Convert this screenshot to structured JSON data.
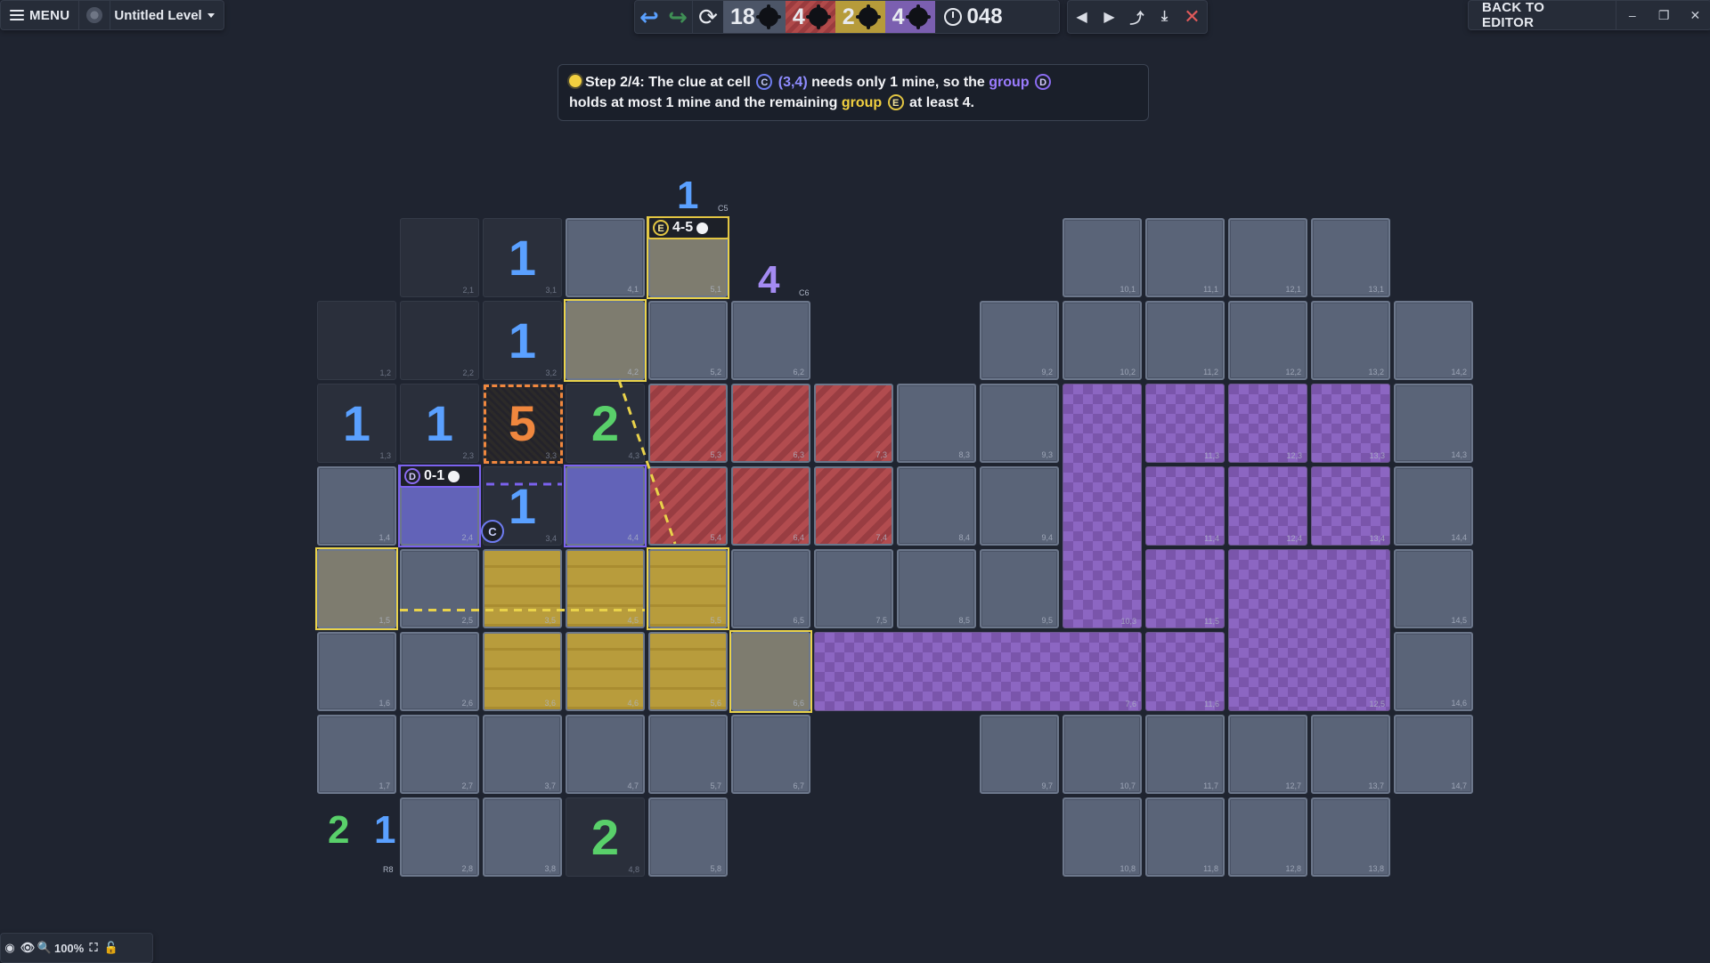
{
  "menu": {
    "label": "MENU"
  },
  "level": {
    "title": "Untitled Level"
  },
  "topbar": {
    "undo_icon": "↩",
    "redo_icon": "↪",
    "restart_icon": "⟳",
    "mine_counts": [
      {
        "id": "total",
        "value": "18",
        "color": "#4c5567"
      },
      {
        "id": "red",
        "value": "4",
        "color": "#b14a4a"
      },
      {
        "id": "yellow",
        "value": "2",
        "color": "#b69b3a"
      },
      {
        "id": "purple",
        "value": "4",
        "color": "#7b5fb0"
      }
    ],
    "timer": "048"
  },
  "nav": {
    "prev": "◀",
    "next": "▶",
    "share": "⤴",
    "download": "⤓",
    "close": "✕"
  },
  "window": {
    "back_to_editor": "BACK TO EDITOR",
    "minimize": "–",
    "restore": "❐",
    "close": "✕"
  },
  "hint": {
    "step": "Step 2/4:",
    "t1": " The clue at cell ",
    "chip_c": "C",
    "cell_ref": "(3,4)",
    "t2": " needs only 1 mine, so the ",
    "group_word_d": "group",
    "chip_d": "D",
    "t3": "holds at most 1 mine and the remaining ",
    "group_word_e": "group",
    "chip_e": "E",
    "t4": " at least 4."
  },
  "grid": {
    "cells": [
      {
        "col": 2,
        "row": 1,
        "type": "rev",
        "coord": "2,1"
      },
      {
        "col": 3,
        "row": 1,
        "type": "rev",
        "coord": "3,1",
        "num": "1",
        "color": "blue"
      },
      {
        "col": 4,
        "row": 1,
        "type": "hid",
        "coord": "4,1"
      },
      {
        "col": 5,
        "row": 1,
        "type": "gy",
        "coord": "5,1"
      },
      {
        "col": 10,
        "row": 1,
        "type": "hid",
        "coord": "10,1"
      },
      {
        "col": 11,
        "row": 1,
        "type": "hid",
        "coord": "11,1"
      },
      {
        "col": 12,
        "row": 1,
        "type": "hid",
        "coord": "12,1"
      },
      {
        "col": 13,
        "row": 1,
        "type": "hid",
        "coord": "13,1"
      },
      {
        "col": 1,
        "row": 2,
        "type": "rev",
        "coord": "1,2"
      },
      {
        "col": 2,
        "row": 2,
        "type": "rev",
        "coord": "2,2"
      },
      {
        "col": 3,
        "row": 2,
        "type": "rev",
        "coord": "3,2",
        "num": "1",
        "color": "blue"
      },
      {
        "col": 4,
        "row": 2,
        "type": "gy",
        "coord": "4,2"
      },
      {
        "col": 5,
        "row": 2,
        "type": "hid",
        "coord": "5,2"
      },
      {
        "col": 6,
        "row": 2,
        "type": "hid",
        "coord": "6,2"
      },
      {
        "col": 9,
        "row": 2,
        "type": "hid",
        "coord": "9,2"
      },
      {
        "col": 10,
        "row": 2,
        "type": "hid",
        "coord": "10,2"
      },
      {
        "col": 11,
        "row": 2,
        "type": "hid",
        "coord": "11,2"
      },
      {
        "col": 12,
        "row": 2,
        "type": "hid",
        "coord": "12,2"
      },
      {
        "col": 13,
        "row": 2,
        "type": "hid",
        "coord": "13,2"
      },
      {
        "col": 14,
        "row": 2,
        "type": "hid",
        "coord": "14,2"
      },
      {
        "col": 1,
        "row": 3,
        "type": "rev",
        "coord": "1,3",
        "num": "1",
        "color": "blue"
      },
      {
        "col": 2,
        "row": 3,
        "type": "rev",
        "coord": "2,3",
        "num": "1",
        "color": "blue"
      },
      {
        "col": 3,
        "row": 3,
        "type": "clue",
        "coord": "3,3",
        "num": "5",
        "color": "orange"
      },
      {
        "col": 4,
        "row": 3,
        "type": "rev",
        "coord": "4,3",
        "num": "2",
        "color": "green"
      },
      {
        "col": 5,
        "row": 3,
        "type": "red",
        "coord": "5,3"
      },
      {
        "col": 6,
        "row": 3,
        "type": "red",
        "coord": "6,3"
      },
      {
        "col": 7,
        "row": 3,
        "type": "red",
        "coord": "7,3"
      },
      {
        "col": 8,
        "row": 3,
        "type": "hid",
        "coord": "8,3"
      },
      {
        "col": 9,
        "row": 3,
        "type": "hid",
        "coord": "9,3"
      },
      {
        "col": 11,
        "row": 3,
        "type": "pur",
        "coord": "11,3"
      },
      {
        "col": 12,
        "row": 3,
        "type": "pur",
        "coord": "12,3"
      },
      {
        "col": 13,
        "row": 3,
        "type": "pur",
        "coord": "13,3"
      },
      {
        "col": 14,
        "row": 3,
        "type": "hid",
        "coord": "14,3"
      },
      {
        "col": 1,
        "row": 4,
        "type": "hid",
        "coord": "1,4"
      },
      {
        "col": 2,
        "row": 4,
        "type": "dsel",
        "coord": "2,4"
      },
      {
        "col": 3,
        "row": 4,
        "type": "rev",
        "coord": "3,4",
        "num": "1",
        "color": "blue"
      },
      {
        "col": 4,
        "row": 4,
        "type": "dsel",
        "coord": "4,4"
      },
      {
        "col": 5,
        "row": 4,
        "type": "red",
        "coord": "5,4"
      },
      {
        "col": 6,
        "row": 4,
        "type": "red",
        "coord": "6,4"
      },
      {
        "col": 7,
        "row": 4,
        "type": "red",
        "coord": "7,4"
      },
      {
        "col": 8,
        "row": 4,
        "type": "hid",
        "coord": "8,4"
      },
      {
        "col": 9,
        "row": 4,
        "type": "hid",
        "coord": "9,4"
      },
      {
        "col": 11,
        "row": 4,
        "type": "pur",
        "coord": "11,4"
      },
      {
        "col": 12,
        "row": 4,
        "type": "pur",
        "coord": "12,4"
      },
      {
        "col": 13,
        "row": 4,
        "type": "pur",
        "coord": "13,4"
      },
      {
        "col": 14,
        "row": 4,
        "type": "hid",
        "coord": "14,4"
      },
      {
        "col": 1,
        "row": 5,
        "type": "gy",
        "coord": "1,5"
      },
      {
        "col": 2,
        "row": 5,
        "type": "hid",
        "coord": "2,5"
      },
      {
        "col": 3,
        "row": 5,
        "type": "brick",
        "coord": "3,5"
      },
      {
        "col": 4,
        "row": 5,
        "type": "brick",
        "coord": "4,5"
      },
      {
        "col": 5,
        "row": 5,
        "type": "ysel",
        "coord": "5,5"
      },
      {
        "col": 6,
        "row": 5,
        "type": "hid",
        "coord": "6,5"
      },
      {
        "col": 7,
        "row": 5,
        "type": "hid",
        "coord": "7,5"
      },
      {
        "col": 8,
        "row": 5,
        "type": "hid",
        "coord": "8,5"
      },
      {
        "col": 9,
        "row": 5,
        "type": "hid",
        "coord": "9,5"
      },
      {
        "col": 11,
        "row": 5,
        "type": "pur",
        "coord": "11,5"
      },
      {
        "col": 14,
        "row": 5,
        "type": "hid",
        "coord": "14,5"
      },
      {
        "col": 1,
        "row": 6,
        "type": "hid",
        "coord": "1,6"
      },
      {
        "col": 2,
        "row": 6,
        "type": "hid",
        "coord": "2,6"
      },
      {
        "col": 3,
        "row": 6,
        "type": "brick",
        "coord": "3,6"
      },
      {
        "col": 4,
        "row": 6,
        "type": "brick",
        "coord": "4,6"
      },
      {
        "col": 5,
        "row": 6,
        "type": "brick",
        "coord": "5,6"
      },
      {
        "col": 6,
        "row": 6,
        "type": "gy",
        "coord": "6,6"
      },
      {
        "col": 11,
        "row": 6,
        "type": "pur",
        "coord": "11,6"
      },
      {
        "col": 14,
        "row": 6,
        "type": "hid",
        "coord": "14,6"
      },
      {
        "col": 1,
        "row": 7,
        "type": "hid",
        "coord": "1,7"
      },
      {
        "col": 2,
        "row": 7,
        "type": "hid",
        "coord": "2,7"
      },
      {
        "col": 3,
        "row": 7,
        "type": "hid",
        "coord": "3,7"
      },
      {
        "col": 4,
        "row": 7,
        "type": "hid",
        "coord": "4,7"
      },
      {
        "col": 5,
        "row": 7,
        "type": "hid",
        "coord": "5,7"
      },
      {
        "col": 6,
        "row": 7,
        "type": "hid",
        "coord": "6,7"
      },
      {
        "col": 9,
        "row": 7,
        "type": "hid",
        "coord": "9,7"
      },
      {
        "col": 10,
        "row": 7,
        "type": "hid",
        "coord": "10,7"
      },
      {
        "col": 11,
        "row": 7,
        "type": "hid",
        "coord": "11,7"
      },
      {
        "col": 12,
        "row": 7,
        "type": "hid",
        "coord": "12,7"
      },
      {
        "col": 13,
        "row": 7,
        "type": "hid",
        "coord": "13,7"
      },
      {
        "col": 14,
        "row": 7,
        "type": "hid",
        "coord": "14,7"
      },
      {
        "col": 2,
        "row": 8,
        "type": "hid",
        "coord": "2,8"
      },
      {
        "col": 3,
        "row": 8,
        "type": "hid",
        "coord": "3,8"
      },
      {
        "col": 4,
        "row": 8,
        "type": "rev",
        "coord": "4,8",
        "num": "2",
        "color": "green"
      },
      {
        "col": 5,
        "row": 8,
        "type": "hid",
        "coord": "5,8"
      },
      {
        "col": 10,
        "row": 8,
        "type": "hid",
        "coord": "10,8"
      },
      {
        "col": 11,
        "row": 8,
        "type": "hid",
        "coord": "11,8"
      },
      {
        "col": 12,
        "row": 8,
        "type": "hid",
        "coord": "12,8"
      },
      {
        "col": 13,
        "row": 8,
        "type": "hid",
        "coord": "13,8"
      }
    ],
    "merged_regions": [
      {
        "name": "purple-column-10",
        "coord": "10,3"
      },
      {
        "name": "purple-row-7-10",
        "coord": "7,6"
      },
      {
        "name": "purple-block-12-13",
        "coord": "12,5"
      }
    ],
    "external_clues": {
      "col5": {
        "value": "1",
        "label": "C5",
        "color": "blue"
      },
      "col6": {
        "value": "4",
        "label": "C6",
        "color": "purple"
      },
      "row8_a": {
        "value": "2",
        "color": "green"
      },
      "row8_b": {
        "value": "1",
        "label": "R8",
        "color": "blue"
      }
    },
    "group_e": {
      "chip": "E",
      "label": "4-5"
    },
    "group_d": {
      "chip": "D",
      "label": "0-1"
    },
    "cell_c_marker": "C"
  },
  "bottom": {
    "palette_icon": "◉",
    "eye_icon": "👁",
    "zoom": "100%",
    "fit_icon": "⛶",
    "lock_icon": "🔓"
  }
}
